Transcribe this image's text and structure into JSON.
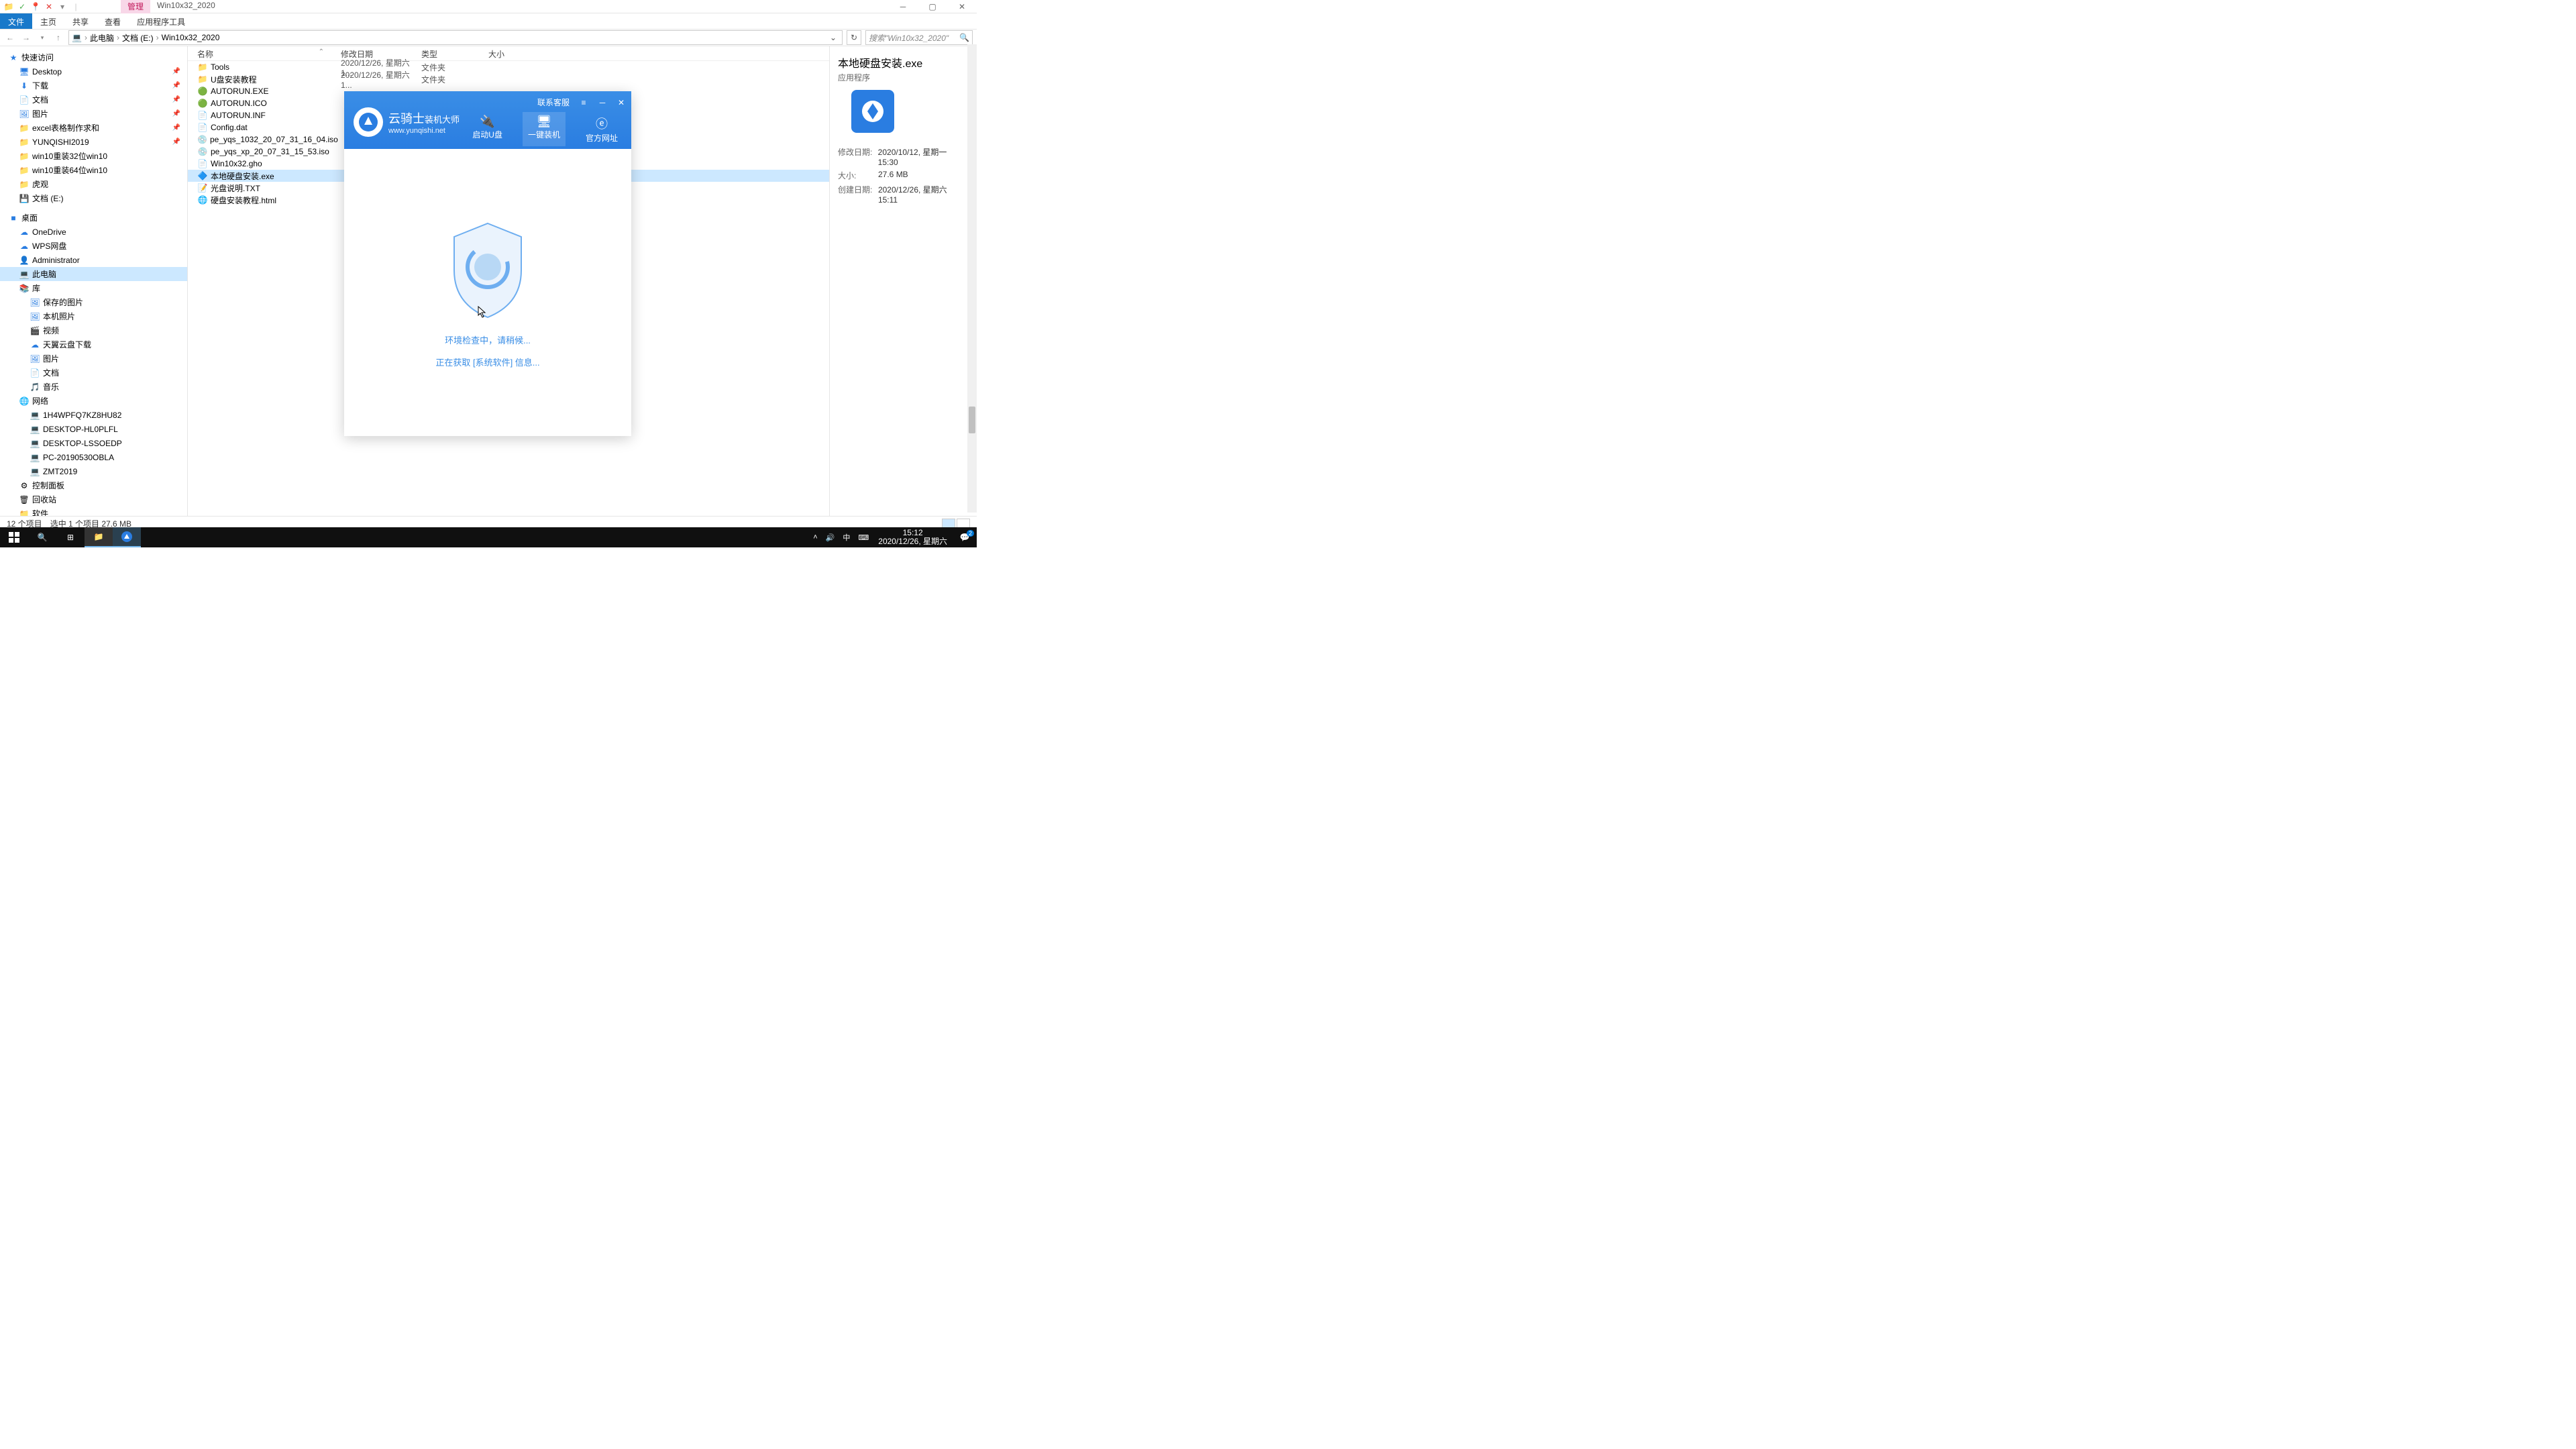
{
  "title_tabs": {
    "manage": "管理",
    "current": "Win10x32_2020"
  },
  "ribbon": {
    "file": "文件",
    "home": "主页",
    "share": "共享",
    "view": "查看",
    "apptools": "应用程序工具"
  },
  "breadcrumb": {
    "pc": "此电脑",
    "drive": "文档 (E:)",
    "folder": "Win10x32_2020"
  },
  "search_placeholder": "搜索\"Win10x32_2020\"",
  "columns": {
    "name": "名称",
    "date": "修改日期",
    "type": "类型",
    "size": "大小"
  },
  "sidebar": {
    "quick": "快速访问",
    "quick_items": [
      "Desktop",
      "下载",
      "文档",
      "图片",
      "excel表格制作求和",
      "YUNQISHI2019",
      "win10重装32位win10",
      "win10重装64位win10",
      "虎观",
      "文档 (E:)"
    ],
    "desktop": "桌面",
    "desktop_items": [
      "OneDrive",
      "WPS网盘",
      "Administrator",
      "此电脑",
      "库"
    ],
    "lib_items": [
      "保存的图片",
      "本机照片",
      "视频",
      "天翼云盘下载",
      "图片",
      "文档",
      "音乐"
    ],
    "network": "网络",
    "network_items": [
      "1H4WPFQ7KZ8HU82",
      "DESKTOP-HL0PLFL",
      "DESKTOP-LSSOEDP",
      "PC-20190530OBLA",
      "ZMT2019"
    ],
    "control": "控制面板",
    "recycle": "回收站",
    "software": "软件"
  },
  "files": [
    {
      "name": "Tools",
      "date": "2020/12/26, 星期六 1...",
      "type": "文件夹",
      "icon": "folder"
    },
    {
      "name": "U盘安装教程",
      "date": "2020/12/26, 星期六 1...",
      "type": "文件夹",
      "icon": "folder"
    },
    {
      "name": "AUTORUN.EXE",
      "date": "",
      "type": "",
      "icon": "exe-green"
    },
    {
      "name": "AUTORUN.ICO",
      "date": "",
      "type": "",
      "icon": "exe-green"
    },
    {
      "name": "AUTORUN.INF",
      "date": "",
      "type": "",
      "icon": "inf"
    },
    {
      "name": "Config.dat",
      "date": "",
      "type": "",
      "icon": "file"
    },
    {
      "name": "pe_yqs_1032_20_07_31_16_04.iso",
      "date": "",
      "type": "",
      "icon": "disc"
    },
    {
      "name": "pe_yqs_xp_20_07_31_15_53.iso",
      "date": "",
      "type": "",
      "icon": "disc"
    },
    {
      "name": "Win10x32.gho",
      "date": "",
      "type": "",
      "icon": "file"
    },
    {
      "name": "本地硬盘安装.exe",
      "date": "",
      "type": "",
      "icon": "app-blue",
      "selected": true
    },
    {
      "name": "光盘说明.TXT",
      "date": "",
      "type": "",
      "icon": "txt"
    },
    {
      "name": "硬盘安装教程.html",
      "date": "",
      "type": "",
      "icon": "html"
    }
  ],
  "details": {
    "title": "本地硬盘安装.exe",
    "subtitle": "应用程序",
    "rows": [
      {
        "label": "修改日期:",
        "value": "2020/10/12, 星期一 15:30"
      },
      {
        "label": "大小:",
        "value": "27.6 MB"
      },
      {
        "label": "创建日期:",
        "value": "2020/12/26, 星期六 15:11"
      }
    ]
  },
  "status": {
    "count": "12 个项目",
    "selection": "选中 1 个项目  27.6 MB"
  },
  "taskbar": {
    "time": "15:12",
    "date": "2020/12/26, 星期六",
    "notif_count": "2",
    "ime": "中"
  },
  "installer": {
    "contact": "联系客服",
    "brand": "云骑士",
    "brand_sub": "装机大师",
    "url": "www.yunqishi.net",
    "tabs": [
      {
        "label": "启动U盘",
        "icon": "usb"
      },
      {
        "label": "一键装机",
        "icon": "monitor",
        "active": true
      },
      {
        "label": "官方网址",
        "icon": "ie"
      }
    ],
    "msg1": "环境检查中，请稍候...",
    "msg2": "正在获取 [系统软件] 信息..."
  }
}
